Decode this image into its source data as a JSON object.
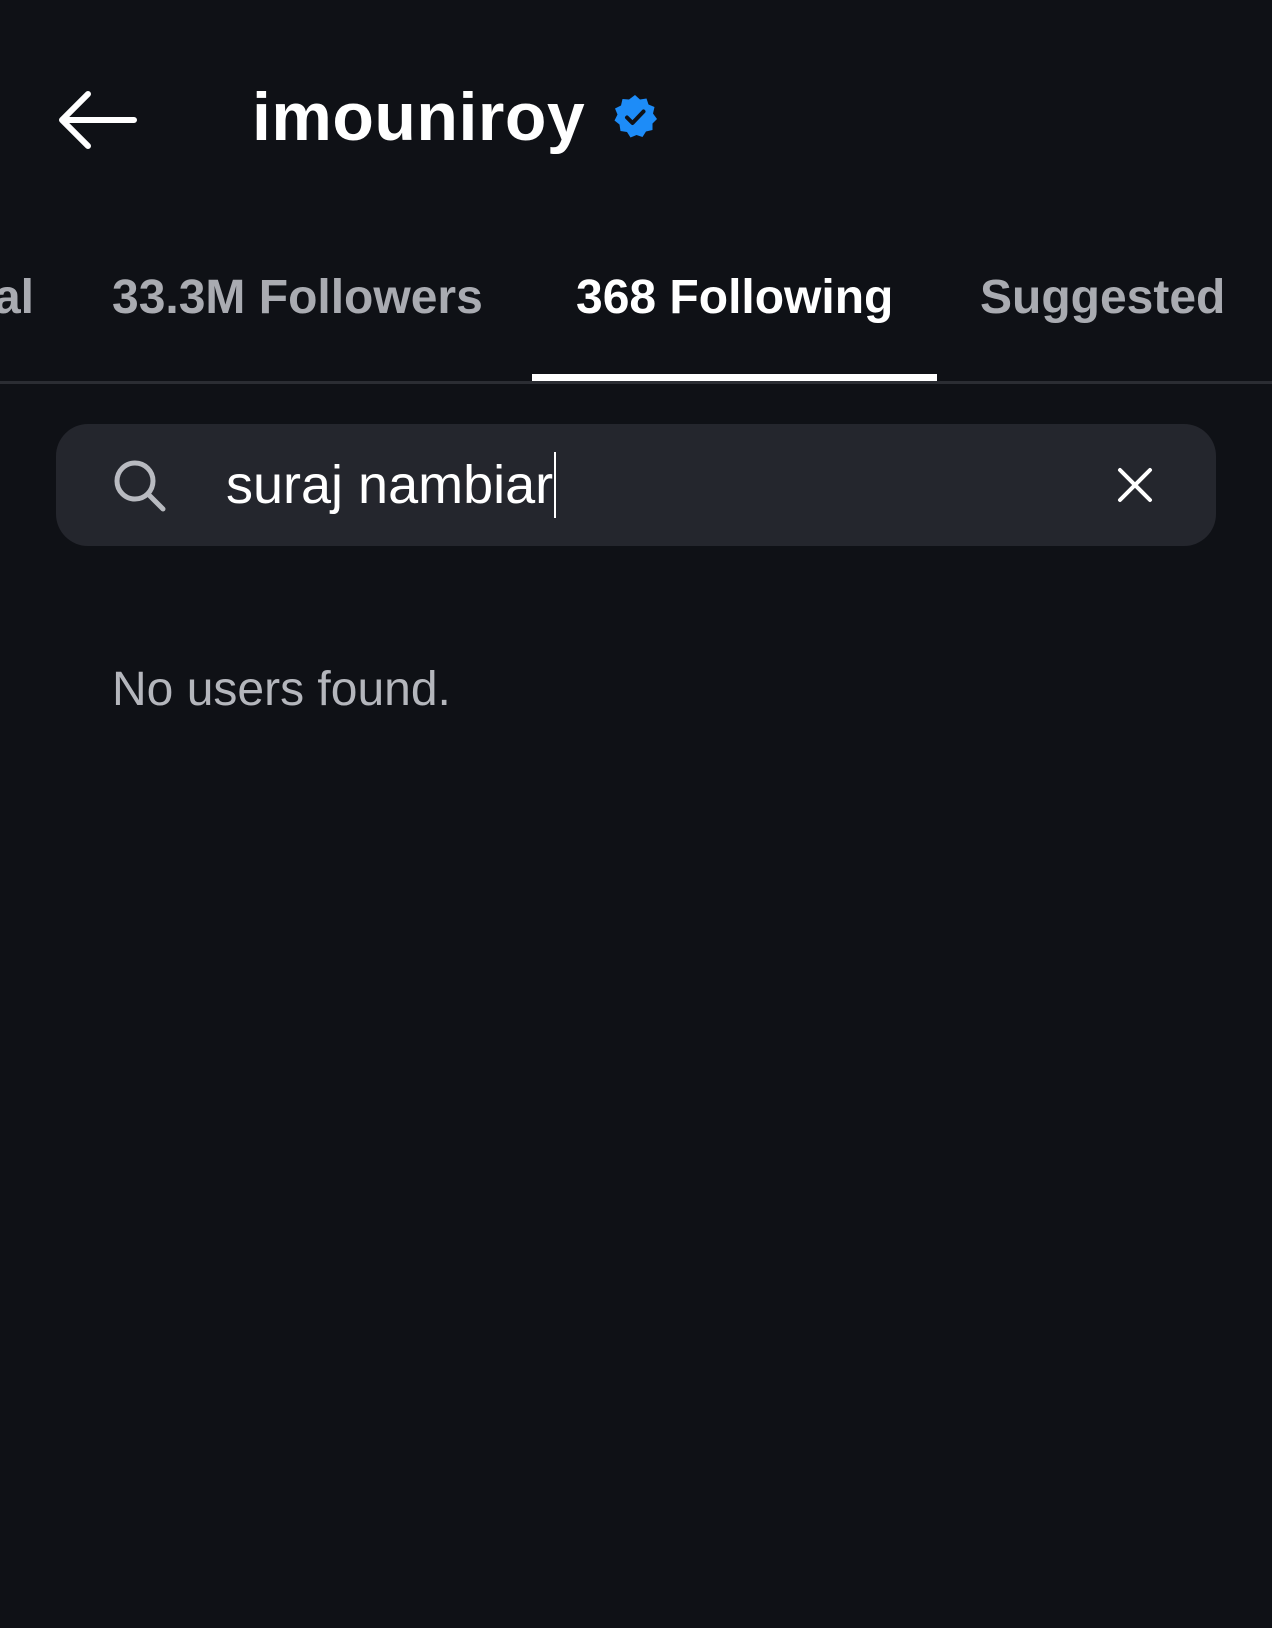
{
  "header": {
    "back_icon": "arrow-left-icon",
    "username": "imouniroy",
    "verified_icon": "verified-badge-icon",
    "verified_color": "#1d8cf8"
  },
  "tabs": [
    {
      "label": "al",
      "active": false
    },
    {
      "label": "33.3M Followers",
      "active": false
    },
    {
      "label": "368 Following",
      "active": true
    },
    {
      "label": "Suggested",
      "active": false
    }
  ],
  "search": {
    "icon": "search-icon",
    "value": "suraj nambiar",
    "clear_icon": "close-icon"
  },
  "results": {
    "empty_message": "No users found."
  },
  "colors": {
    "background": "#0f1116",
    "search_bg": "#24262d",
    "active_tab": "#ffffff",
    "inactive_tab": "#a9abb1"
  }
}
